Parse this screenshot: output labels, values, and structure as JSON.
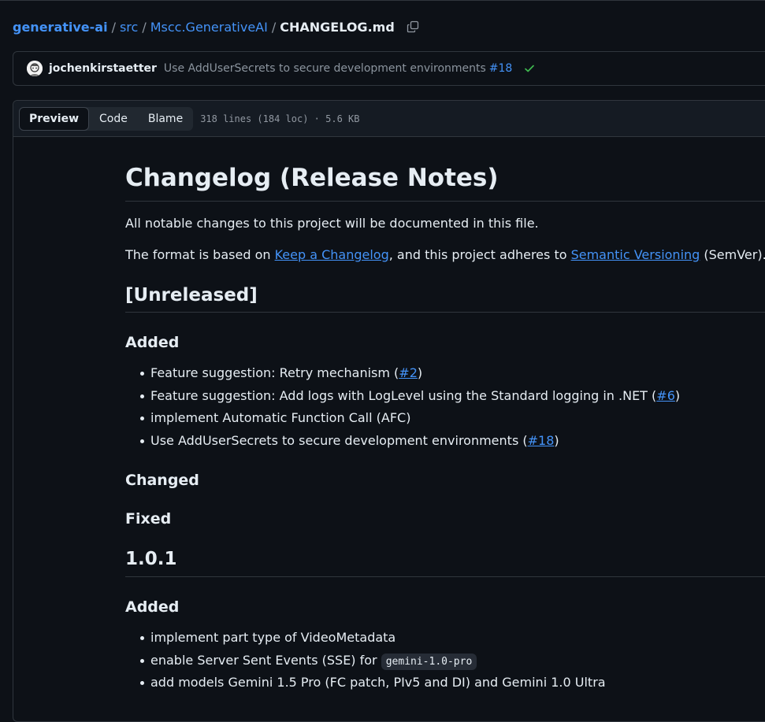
{
  "breadcrumb": {
    "repo": "generative-ai",
    "separator": "/",
    "folder1": "src",
    "folder2": "Mscc.GenerativeAI",
    "file": "CHANGELOG.md"
  },
  "commit": {
    "author": "jochenkirstaetter",
    "message": "Use AddUserSecrets to secure development environments",
    "pr": "#18",
    "status": "success"
  },
  "file_header": {
    "tabs": [
      "Preview",
      "Code",
      "Blame"
    ],
    "active_tab": "Preview",
    "meta": "318 lines (184 loc) · 5.6 KB"
  },
  "markdown": {
    "title": "Changelog (Release Notes)",
    "intro": "All notable changes to this project will be documented in this file.",
    "format_prefix": "The format is based on ",
    "format_link1": "Keep a Changelog",
    "format_mid": ", and this project adheres to ",
    "format_link2": "Semantic Versioning",
    "format_suffix": " (SemVer).",
    "unreleased": {
      "heading": "[Unreleased]",
      "added_heading": "Added",
      "added_items": [
        {
          "text": "Feature suggestion: Retry mechanism (",
          "link": "#2",
          "after": ")"
        },
        {
          "text": "Feature suggestion: Add logs with LogLevel using the Standard logging in .NET (",
          "link": "#6",
          "after": ")"
        },
        {
          "text": "implement Automatic Function Call (AFC)",
          "link": "",
          "after": ""
        },
        {
          "text": "Use AddUserSecrets to secure development environments (",
          "link": "#18",
          "after": ")"
        }
      ],
      "changed_heading": "Changed",
      "fixed_heading": "Fixed"
    },
    "release_101": {
      "heading": "1.0.1",
      "added_heading": "Added",
      "item1": "implement part type of VideoMetadata",
      "item2_text": "enable Server Sent Events (SSE) for ",
      "item2_code": "gemini-1.0-pro",
      "item3": "add models Gemini 1.5 Pro (FC patch, PIv5 and DI) and Gemini 1.0 Ultra"
    }
  },
  "colors": {
    "background": "#0d1117",
    "link": "#4493f8",
    "text": "#e6edf3",
    "muted": "#8b949e",
    "border": "#30363d",
    "success": "#3fb950"
  }
}
